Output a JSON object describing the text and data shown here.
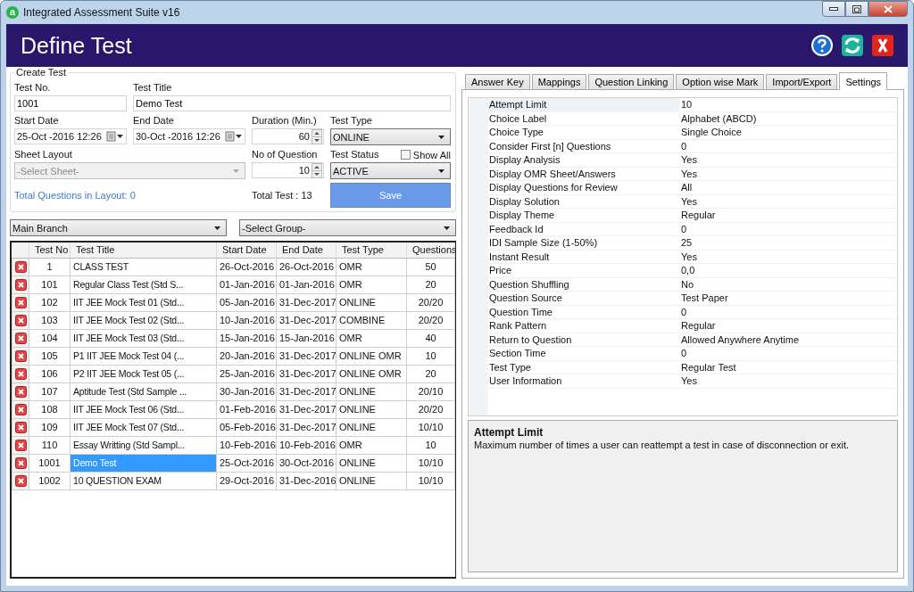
{
  "window": {
    "icon_letter": "a",
    "title": "Integrated Assessment Suite v16"
  },
  "header": {
    "title": "Define Test"
  },
  "create_test": {
    "legend": "Create Test",
    "test_no": {
      "label": "Test No.",
      "value": "1001"
    },
    "test_title": {
      "label": "Test Title",
      "value": "Demo Test"
    },
    "start_date": {
      "label": "Start Date",
      "value": "25-Oct -2016 12:26"
    },
    "end_date": {
      "label": "End Date",
      "value": "30-Oct -2016 12:26"
    },
    "duration": {
      "label": "Duration (Min.)",
      "value": "60"
    },
    "test_type": {
      "label": "Test Type",
      "value": "ONLINE"
    },
    "sheet_layout": {
      "label": "Sheet Layout",
      "value": "-Select Sheet-",
      "disabled": true
    },
    "no_of_question": {
      "label": "No of Question",
      "value": "10"
    },
    "test_status": {
      "label": "Test Status",
      "value": "ACTIVE"
    },
    "show_all": {
      "label": "Show All",
      "checked": false
    },
    "total_questions_link": "Total Questions in Layout: 0",
    "total_test": "Total Test : 13",
    "save_button": "Save"
  },
  "filters": [
    {
      "value": "Main Branch"
    },
    {
      "value": "-Select Group-"
    }
  ],
  "table": {
    "columns": [
      "Test No",
      "Test Title",
      "Start Date",
      "End Date",
      "Test Type",
      "Questions"
    ],
    "rows": [
      {
        "cells": [
          "1",
          "CLASS TEST",
          "26-Oct-2016",
          "26-Oct-2016",
          "OMR",
          "50"
        ],
        "selected": false
      },
      {
        "cells": [
          "101",
          "Regular Class Test (Std S...",
          "01-Jan-2016",
          "01-Jan-2016",
          "OMR",
          "20"
        ],
        "selected": false
      },
      {
        "cells": [
          "102",
          "IIT JEE Mock Test 01 (Std...",
          "05-Jan-2016",
          "31-Dec-2017",
          "ONLINE",
          "20/20"
        ],
        "selected": false
      },
      {
        "cells": [
          "103",
          "IIT JEE Mock Test 02 (Std...",
          "10-Jan-2016",
          "31-Dec-2017",
          "COMBINE",
          "20/20"
        ],
        "selected": false
      },
      {
        "cells": [
          "104",
          "IIT JEE Mock Test 03 (Std...",
          "15-Jan-2016",
          "15-Jan-2016",
          "OMR",
          "40"
        ],
        "selected": false
      },
      {
        "cells": [
          "105",
          "P1 IIT JEE Mock Test 04 (...",
          "20-Jan-2016",
          "31-Dec-2017",
          "ONLINE OMR",
          "10"
        ],
        "selected": false
      },
      {
        "cells": [
          "106",
          "P2 IIT JEE Mock Test 05 (...",
          "25-Jan-2016",
          "31-Dec-2017",
          "ONLINE OMR",
          "20"
        ],
        "selected": false
      },
      {
        "cells": [
          "107",
          "Aptitude Test (Std Sample ...",
          "30-Jan-2016",
          "31-Dec-2017",
          "ONLINE",
          "20/10"
        ],
        "selected": false
      },
      {
        "cells": [
          "108",
          "IIT JEE Mock Test 06 (Std...",
          "01-Feb-2016",
          "31-Dec-2017",
          "ONLINE",
          "20/20"
        ],
        "selected": false
      },
      {
        "cells": [
          "109",
          "IIT JEE Mock Test 07 (Std...",
          "05-Feb-2016",
          "31-Dec-2017",
          "ONLINE",
          "10/10"
        ],
        "selected": false
      },
      {
        "cells": [
          "110",
          "Essay Writting (Std Sampl...",
          "10-Feb-2016",
          "10-Feb-2016",
          "OMR",
          "10"
        ],
        "selected": false
      },
      {
        "cells": [
          "1001",
          "Demo Test",
          "25-Oct-2016",
          "30-Oct-2016",
          "ONLINE",
          "10/10"
        ],
        "selected": true
      },
      {
        "cells": [
          "1002",
          "10 QUESTION EXAM",
          "29-Oct-2016",
          "31-Dec-2016",
          "ONLINE",
          "10/10"
        ],
        "selected": false
      }
    ]
  },
  "tabs": [
    {
      "label": "Answer Key",
      "selected": false
    },
    {
      "label": "Mappings",
      "selected": false
    },
    {
      "label": "Question Linking",
      "selected": false
    },
    {
      "label": "Option wise Mark",
      "selected": false
    },
    {
      "label": "Import/Export",
      "selected": false
    },
    {
      "label": "Settings",
      "selected": true
    }
  ],
  "settings": [
    {
      "name": "Attempt Limit",
      "value": "10",
      "selected": true
    },
    {
      "name": "Choice Label",
      "value": "Alphabet (ABCD)",
      "selected": false
    },
    {
      "name": "Choice Type",
      "value": "Single Choice",
      "selected": false
    },
    {
      "name": "Consider First [n] Questions",
      "value": "0",
      "selected": false
    },
    {
      "name": "Display Analysis",
      "value": "Yes",
      "selected": false
    },
    {
      "name": "Display OMR Sheet/Answers",
      "value": "Yes",
      "selected": false
    },
    {
      "name": "Display Questions for Review",
      "value": "All",
      "selected": false
    },
    {
      "name": "Display Solution",
      "value": "Yes",
      "selected": false
    },
    {
      "name": "Display Theme",
      "value": "Regular",
      "selected": false
    },
    {
      "name": "Feedback Id",
      "value": "0",
      "selected": false
    },
    {
      "name": "IDI Sample Size (1-50%)",
      "value": "25",
      "selected": false
    },
    {
      "name": "Instant Result",
      "value": "Yes",
      "selected": false
    },
    {
      "name": "Price",
      "value": "0,0",
      "selected": false
    },
    {
      "name": "Question Shuffling",
      "value": "No",
      "selected": false
    },
    {
      "name": "Question Source",
      "value": "Test Paper",
      "selected": false
    },
    {
      "name": "Question Time",
      "value": "0",
      "selected": false
    },
    {
      "name": "Rank Pattern",
      "value": "Regular",
      "selected": false
    },
    {
      "name": "Return to Question",
      "value": "Allowed Anywhere Anytime",
      "selected": false
    },
    {
      "name": "Section Time",
      "value": "0",
      "selected": false
    },
    {
      "name": "Test Type",
      "value": "Regular Test",
      "selected": false
    },
    {
      "name": "User Information",
      "value": "Yes",
      "selected": false
    }
  ],
  "description": {
    "title": "Attempt Limit",
    "text": "Maximum number of times a user can reattempt a test in case of disconnection or exit."
  }
}
